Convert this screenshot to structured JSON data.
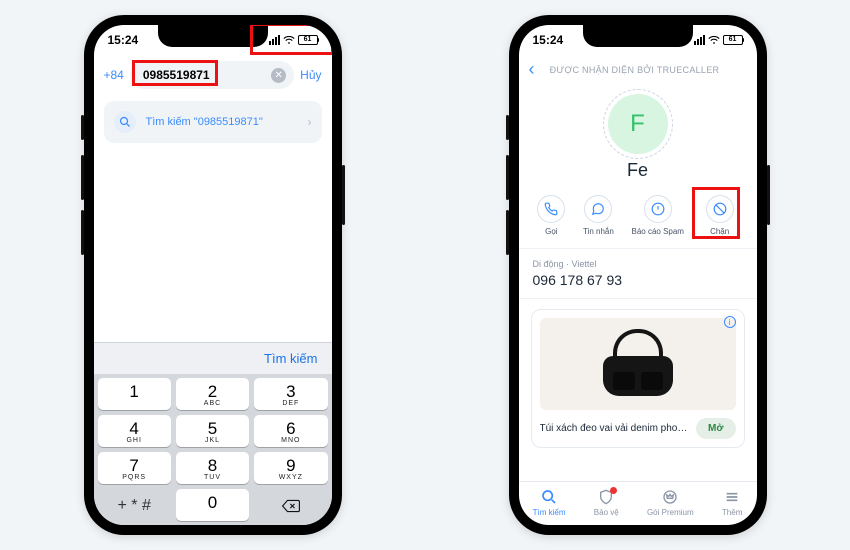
{
  "status": {
    "time": "15:24",
    "battery": "61"
  },
  "p1": {
    "country_code": "+84",
    "phone_value": "0985519871",
    "cancel": "Hủy",
    "result_prefix": "Tìm kiếm",
    "result_query": "\"0985519871\"",
    "kb_search": "Tìm kiếm",
    "keys": [
      {
        "d": "1",
        "l": ""
      },
      {
        "d": "2",
        "l": "ABC"
      },
      {
        "d": "3",
        "l": "DEF"
      },
      {
        "d": "4",
        "l": "GHI"
      },
      {
        "d": "5",
        "l": "JKL"
      },
      {
        "d": "6",
        "l": "MNO"
      },
      {
        "d": "7",
        "l": "PQRS"
      },
      {
        "d": "8",
        "l": "TUV"
      },
      {
        "d": "9",
        "l": "WXYZ"
      }
    ],
    "zero": "0",
    "symbols": "+ * #"
  },
  "p2": {
    "header": "ĐƯỢC NHẬN DIỆN BỞI TRUECALLER",
    "avatar_initial": "F",
    "contact_name": "Fe",
    "actions": {
      "call": "Gọi",
      "message": "Tin nhắn",
      "spam": "Báo cáo Spam",
      "block": "Chặn"
    },
    "number_label": "Di động · Viettel",
    "number": "096 178 67 93",
    "ad": {
      "title": "Túi xách đeo vai vải denim phon...",
      "cta": "Mở"
    },
    "tabs": {
      "search": "Tìm kiếm",
      "protect": "Bảo vệ",
      "premium": "Gói Premium",
      "more": "Thêm"
    }
  }
}
